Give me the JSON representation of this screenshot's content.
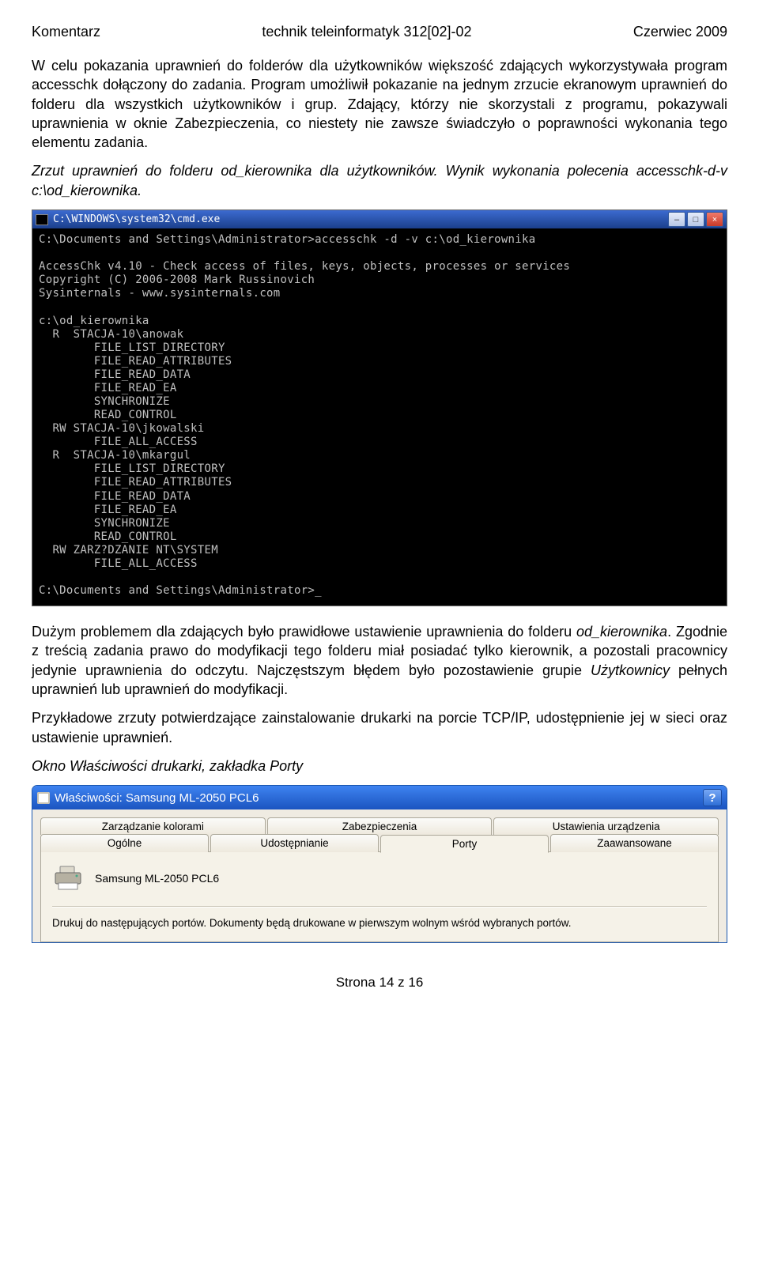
{
  "header": {
    "left": "Komentarz",
    "center": "technik teleinformatyk 312[02]-02",
    "right": "Czerwiec 2009"
  },
  "para1": "W celu pokazania uprawnień do folderów dla użytkowników większość zdających wykorzystywała program accesschk dołączony do zadania. Program umożliwił pokazanie na jednym zrzucie ekranowym uprawnień do folderu dla wszystkich użytkowników i grup. Zdający, którzy nie skorzystali z programu, pokazywali uprawnienia w oknie Zabezpieczenia, co niestety nie zawsze świadczyło o poprawności wykonania tego elementu zadania.",
  "para2": "Zrzut uprawnień do folderu od_kierownika dla użytkowników. Wynik wykonania polecenia accesschk-d-v c:\\od_kierownika.",
  "cmd": {
    "title": "C:\\WINDOWS\\system32\\cmd.exe",
    "body": "C:\\Documents and Settings\\Administrator>accesschk -d -v c:\\od_kierownika\n\nAccessChk v4.10 - Check access of files, keys, objects, processes or services\nCopyright (C) 2006-2008 Mark Russinovich\nSysinternals - www.sysinternals.com\n\nc:\\od_kierownika\n  R  STACJA-10\\anowak\n        FILE_LIST_DIRECTORY\n        FILE_READ_ATTRIBUTES\n        FILE_READ_DATA\n        FILE_READ_EA\n        SYNCHRONIZE\n        READ_CONTROL\n  RW STACJA-10\\jkowalski\n        FILE_ALL_ACCESS\n  R  STACJA-10\\mkargul\n        FILE_LIST_DIRECTORY\n        FILE_READ_ATTRIBUTES\n        FILE_READ_DATA\n        FILE_READ_EA\n        SYNCHRONIZE\n        READ_CONTROL\n  RW ZARZ?DZANIE NT\\SYSTEM\n        FILE_ALL_ACCESS\n\nC:\\Documents and Settings\\Administrator>_"
  },
  "para3_a": "Dużym problemem dla zdających było prawidłowe ustawienie uprawnienia do folderu ",
  "para3_b_italic": "od_kierownika",
  "para3_c": ". Zgodnie z treścią zadania prawo do modyfikacji tego folderu miał posiadać tylko kierownik, a pozostali pracownicy jedynie uprawnienia do odczytu. Najczęstszym błędem było pozostawienie grupie ",
  "para3_d_italic": "Użytkownicy",
  "para3_e": " pełnych uprawnień lub uprawnień do modyfikacji.",
  "para4": "Przykładowe zrzuty potwierdzające zainstalowanie drukarki na porcie TCP/IP, udostępnienie jej w sieci oraz ustawienie uprawnień.",
  "para5": "Okno Właściwości drukarki, zakładka Porty",
  "prop": {
    "title": "Właściwości: Samsung ML-2050 PCL6",
    "tabs_row1": [
      "Zarządzanie kolorami",
      "Zabezpieczenia",
      "Ustawienia urządzenia"
    ],
    "tabs_row2": [
      "Ogólne",
      "Udostępnianie",
      "Porty",
      "Zaawansowane"
    ],
    "active_tab": "Porty",
    "printer_name": "Samsung ML-2050 PCL6",
    "ports_text": "Drukuj do następujących portów. Dokumenty będą drukowane w pierwszym wolnym wśród wybranych portów."
  },
  "footer": "Strona 14 z 16"
}
